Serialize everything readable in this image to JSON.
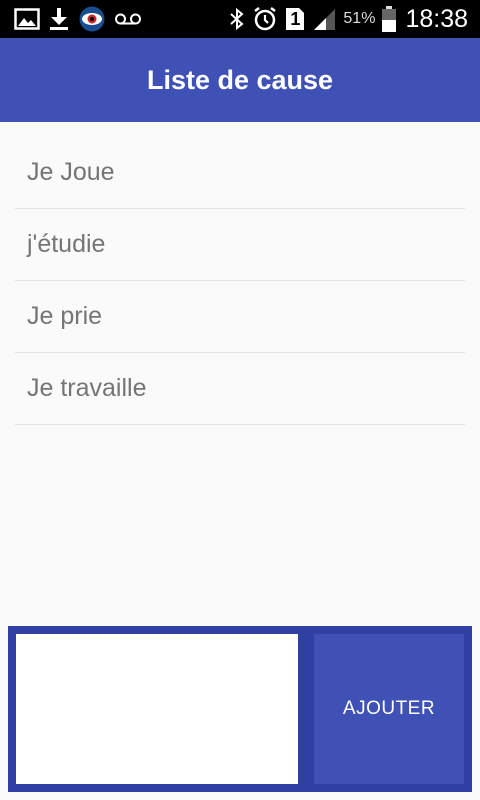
{
  "status_bar": {
    "icons": [
      "image-icon",
      "download-icon",
      "eye-icon",
      "voicemail-icon",
      "bluetooth-icon",
      "alarm-icon",
      "sim-1-icon",
      "signal-icon",
      "battery-icon"
    ],
    "sim_label": "1",
    "battery_percent": "51%",
    "time": "18:38"
  },
  "app_bar": {
    "title": "Liste de cause",
    "color": "#3f51b5"
  },
  "causes": {
    "items": [
      {
        "label": "Je Joue"
      },
      {
        "label": "j'étudie"
      },
      {
        "label": "Je prie"
      },
      {
        "label": "Je travaille"
      }
    ]
  },
  "add_form": {
    "input_value": "",
    "button_label": "AJOUTER"
  }
}
